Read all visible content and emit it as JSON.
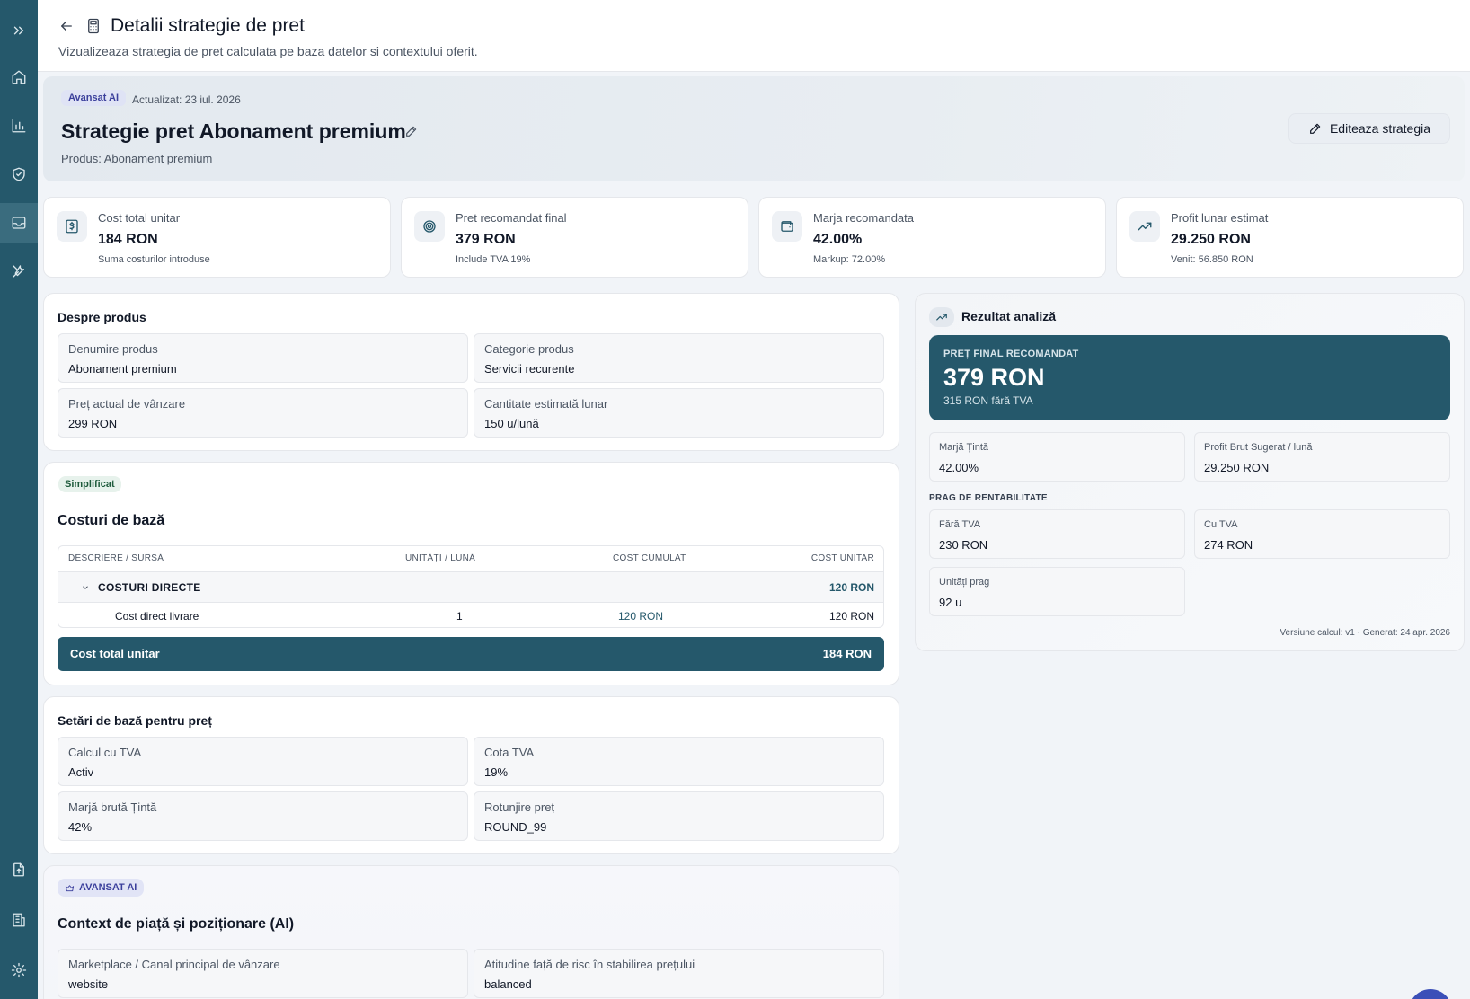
{
  "header": {
    "title": "Detalii strategie de pret",
    "subtitle": "Vizualizeaza strategia de pret calculata pe baza datelor si contextului oferit."
  },
  "sidebar": {
    "items": [
      {
        "icon": "chevrons-right-icon"
      },
      {
        "icon": "home-icon"
      },
      {
        "icon": "bar-chart-icon"
      },
      {
        "icon": "shield-icon"
      },
      {
        "icon": "inbox-icon",
        "active": true
      },
      {
        "icon": "tools-icon"
      },
      {
        "icon": "file-upload-icon"
      },
      {
        "icon": "building-icon"
      },
      {
        "icon": "settings-icon"
      }
    ]
  },
  "hero": {
    "badge": "Avansat AI",
    "updated": "Actualizat: 23 iul. 2026",
    "title": "Strategie pret Abonament premium",
    "product": "Produs: Abonament premium",
    "edit_button": "Editeaza strategia"
  },
  "kpis": [
    {
      "label": "Cost total unitar",
      "value": "184 RON",
      "sub": "Suma costurilor introduse",
      "icon": "dollar-icon"
    },
    {
      "label": "Pret recomandat final",
      "value": "379 RON",
      "sub": "Include TVA 19%",
      "icon": "target-icon"
    },
    {
      "label": "Marja recomandata",
      "value": "42.00%",
      "sub": "Markup: 72.00%",
      "icon": "wallet-icon"
    },
    {
      "label": "Profit lunar estimat",
      "value": "29.250 RON",
      "sub": "Venit: 56.850 RON",
      "icon": "trending-up-icon"
    }
  ],
  "about": {
    "title": "Despre produs",
    "fields": [
      {
        "label": "Denumire produs",
        "value": "Abonament premium"
      },
      {
        "label": "Categorie produs",
        "value": "Servicii recurente"
      },
      {
        "label": "Preț actual de vânzare",
        "value": "299 RON"
      },
      {
        "label": "Cantitate estimată lunar",
        "value": "150 u/lună"
      }
    ]
  },
  "costs": {
    "badge": "Simplificat",
    "title": "Costuri de bază",
    "headers": [
      "DESCRIERE / SURSĂ",
      "UNITĂȚI / LUNĂ",
      "COST CUMULAT",
      "COST UNITAR"
    ],
    "group": {
      "label": "COSTURI DIRECTE",
      "total": "120 RON"
    },
    "rows": [
      {
        "desc": "Cost direct livrare",
        "units": "1",
        "cumulative": "120 RON",
        "unit": "120 RON"
      }
    ],
    "total_label": "Cost total unitar",
    "total_value": "184 RON"
  },
  "settings": {
    "title": "Setări de bază pentru preț",
    "fields": [
      {
        "label": "Calcul cu TVA",
        "value": "Activ"
      },
      {
        "label": "Cota TVA",
        "value": "19%"
      },
      {
        "label": "Marjă brută Țintă",
        "value": "42%"
      },
      {
        "label": "Rotunjire preț",
        "value": "ROUND_99"
      }
    ]
  },
  "market": {
    "badge": "AVANSAT AI",
    "title": "Context de piață și poziționare (AI)",
    "fields": [
      {
        "label": "Marketplace / Canal principal de vânzare",
        "value": "website"
      },
      {
        "label": "Atitudine față de risc în stabilirea prețului",
        "value": "balanced"
      }
    ]
  },
  "result": {
    "title": "Rezultat analiză",
    "final_label": "PREȚ FINAL RECOMANDAT",
    "final_value": "379 RON",
    "final_sub": "315 RON fără TVA",
    "margin_label": "Marjă Țintă",
    "margin_value": "42.00%",
    "profit_label": "Profit Brut Sugerat / lună",
    "profit_value": "29.250 RON",
    "breakeven_title": "PRAG DE RENTABILITATE",
    "no_vat_label": "Fără TVA",
    "no_vat_value": "230 RON",
    "vat_label": "Cu TVA",
    "vat_value": "274 RON",
    "units_label": "Unități prag",
    "units_value": "92 u",
    "version": "Versiune calcul: v1 · Generat: 24 apr. 2026"
  },
  "colors": {
    "sidebar": "#25586b",
    "accent": "#25586b",
    "ai_badge": "#3b3f9c"
  }
}
